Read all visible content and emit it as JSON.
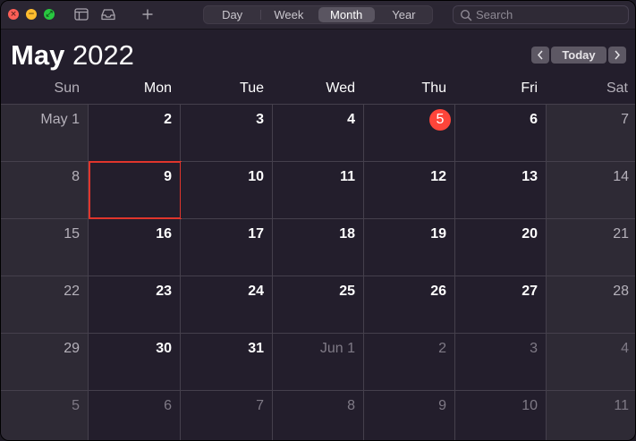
{
  "window": {
    "controls": [
      "close",
      "minimize",
      "zoom"
    ],
    "toolbar_icons": [
      "calendar-list-icon",
      "inbox-icon",
      "add-icon"
    ]
  },
  "view_tabs": [
    {
      "label": "Day",
      "selected": false
    },
    {
      "label": "Week",
      "selected": false
    },
    {
      "label": "Month",
      "selected": true
    },
    {
      "label": "Year",
      "selected": false
    }
  ],
  "search": {
    "placeholder": "Search",
    "value": ""
  },
  "header": {
    "month": "May",
    "year": "2022",
    "today_label": "Today"
  },
  "weekdays": [
    "Sun",
    "Mon",
    "Tue",
    "Wed",
    "Thu",
    "Fri",
    "Sat"
  ],
  "weeks": [
    [
      "May 1",
      "2",
      "3",
      "4",
      "5",
      "6",
      "7"
    ],
    [
      "8",
      "9",
      "10",
      "11",
      "12",
      "13",
      "14"
    ],
    [
      "15",
      "16",
      "17",
      "18",
      "19",
      "20",
      "21"
    ],
    [
      "22",
      "23",
      "24",
      "25",
      "26",
      "27",
      "28"
    ],
    [
      "29",
      "30",
      "31",
      "Jun 1",
      "2",
      "3",
      "4"
    ],
    [
      "5",
      "6",
      "7",
      "8",
      "9",
      "10",
      "11"
    ]
  ],
  "today": {
    "week": 0,
    "day": 4
  },
  "selected": {
    "week": 1,
    "day": 1
  },
  "other_month_cells": [
    [
      4,
      3
    ],
    [
      4,
      4
    ],
    [
      4,
      5
    ],
    [
      4,
      6
    ],
    [
      5,
      0
    ],
    [
      5,
      1
    ],
    [
      5,
      2
    ],
    [
      5,
      3
    ],
    [
      5,
      4
    ],
    [
      5,
      5
    ],
    [
      5,
      6
    ]
  ],
  "colors": {
    "today_badge": "#fe453a",
    "selection_border": "#e0352c",
    "background": "#231e2c"
  }
}
